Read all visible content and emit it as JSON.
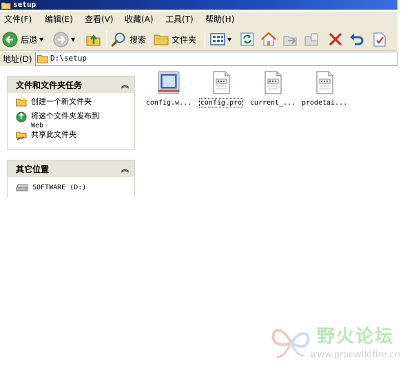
{
  "window": {
    "title": "setup"
  },
  "menu": [
    "文件(F)",
    "编辑(E)",
    "查看(V)",
    "收藏(A)",
    "工具(T)",
    "帮助(H)"
  ],
  "toolbar": {
    "back_label": "后退",
    "search_label": "搜索",
    "folders_label": "文件夹"
  },
  "address": {
    "label": "地址(D)",
    "value": "D:\\setup"
  },
  "file_tasks": {
    "title": "文件和文件夹任务",
    "items": [
      "创建一个新文件夹",
      "将这个文件夹发布到",
      "Web",
      "共享此文件夹"
    ]
  },
  "other_places": {
    "title": "其它位置",
    "items": [
      "SOFTWARE (D:)"
    ]
  },
  "files": [
    {
      "name": "config.w...",
      "icon": "exe-icon"
    },
    {
      "name": "config.pro",
      "icon": "document-icon",
      "selected": true
    },
    {
      "name": "current_...",
      "icon": "document-icon"
    },
    {
      "name": "prodetai...",
      "icon": "document-icon"
    }
  ],
  "watermark": {
    "text": "野火论坛",
    "url": "www.proewildfire.cn"
  }
}
